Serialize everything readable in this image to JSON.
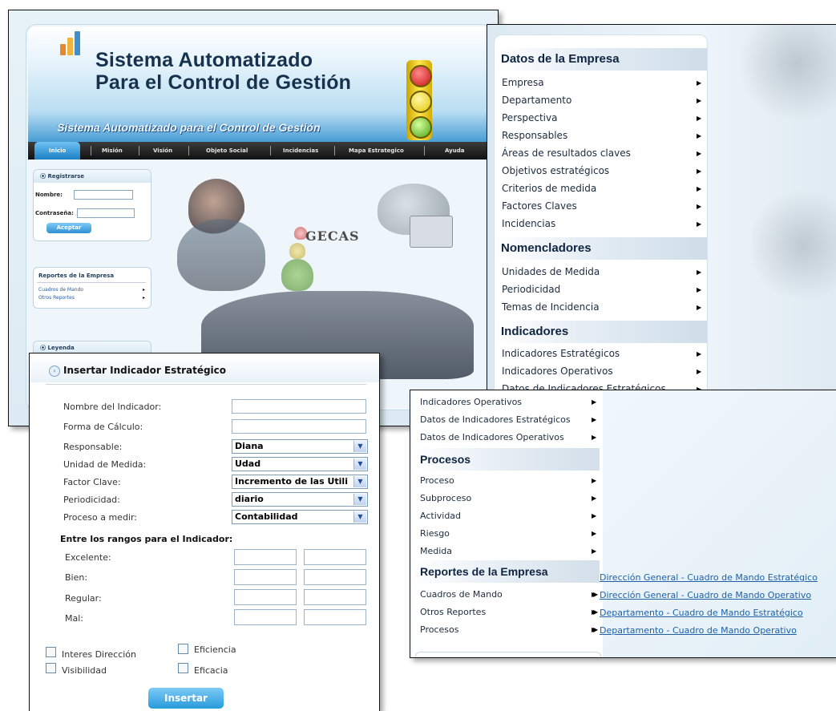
{
  "main_site": {
    "title_line1": "Sistema Automatizado",
    "title_line2": "Para el Control de Gestión",
    "subtitle": "Sistema Automatizado para el Control de Gestión",
    "nav": [
      "Inicio",
      "Misión",
      "Visión",
      "Objeto Social",
      "Incidencias",
      "Mapa Estrategico",
      "Ayuda"
    ],
    "login": {
      "header": "Registrarse",
      "name_label": "Nombre:",
      "password_label": "Contraseña:",
      "button": "Aceptar"
    },
    "reports_box": {
      "header": "Reportes de la Empresa",
      "items": [
        "Cuadros de Mando",
        "Otros Reportes"
      ]
    },
    "legend_header": "Leyenda",
    "photo_text": "GECAS"
  },
  "menu_window": {
    "sections": [
      {
        "title": "Datos de la Empresa",
        "items": [
          "Empresa",
          "Departamento",
          "Perspectiva",
          "Responsables",
          "Áreas de resultados claves",
          "Objetivos estratégicos",
          "Criterios de medida",
          "Factores Claves",
          "Incidencias"
        ]
      },
      {
        "title": "Nomencladores",
        "items": [
          "Unidades de Medida",
          "Periodicidad",
          "Temas de Incidencia"
        ]
      },
      {
        "title": "Indicadores",
        "items": [
          "Indicadores Estratégicos",
          "Indicadores Operativos",
          "Datos de Indicadores Estratégicos"
        ]
      }
    ]
  },
  "reports_window": {
    "top_items": [
      "Indicadores Operativos",
      "Datos de Indicadores Estratégicos",
      "Datos de Indicadores Operativos"
    ],
    "procesos_title": "Procesos",
    "procesos_items": [
      "Proceso",
      "Subproceso",
      "Actividad",
      "Riesgo",
      "Medida"
    ],
    "reportes_title": "Reportes de la Empresa",
    "reportes_items": [
      "Cuadros de Mando",
      "Otros Reportes",
      "Procesos"
    ],
    "submenu_links": [
      "Dirección General - Cuadro de Mando Estratégico",
      "Dirección General - Cuadro de Mando Operativo",
      "Departamento - Cuadro de Mando Estratégico",
      "Departamento - Cuadro de Mando Operativo"
    ]
  },
  "form": {
    "title": "Insertar Indicador Estratégico",
    "fields": {
      "nombre": {
        "label": "Nombre del Indicador:",
        "value": ""
      },
      "forma": {
        "label": "Forma de Cálculo:",
        "value": ""
      },
      "responsable": {
        "label": "Responsable:",
        "value": "Diana"
      },
      "unidad": {
        "label": "Unidad de Medida:",
        "value": "Udad"
      },
      "factor": {
        "label": "Factor Clave:",
        "value": "Incremento de las Utili"
      },
      "periodicidad": {
        "label": "Periodicidad:",
        "value": "diario"
      },
      "proceso": {
        "label": "Proceso a medir:",
        "value": "Contabilidad"
      }
    },
    "ranges_title": "Entre los rangos para el Indicador:",
    "ranges": [
      "Excelente:",
      "Bien:",
      "Regular:",
      "Mal:"
    ],
    "checkboxes": [
      "Interes Dirección",
      "Eficiencia",
      "Visibilidad",
      "Eficacia"
    ],
    "submit": "Insertar"
  }
}
